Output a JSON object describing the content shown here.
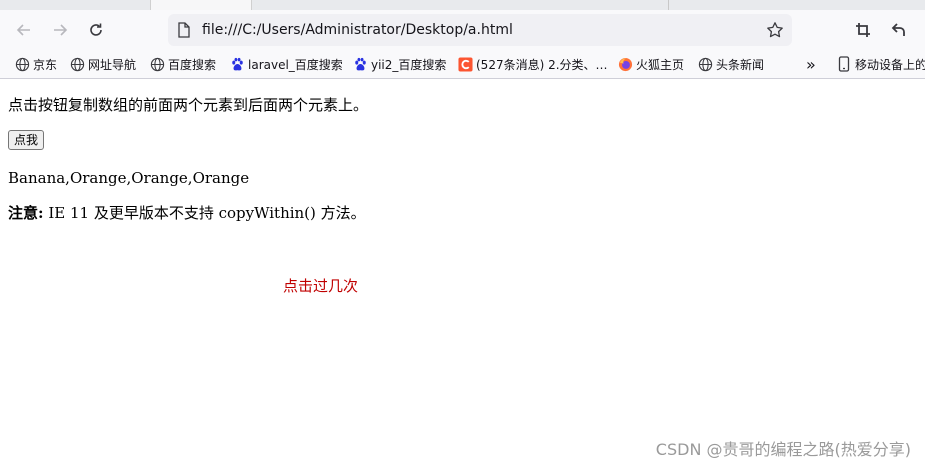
{
  "browser": {
    "url": "file:///C:/Users/Administrator/Desktop/a.html",
    "bookmarks": [
      {
        "label": "京东",
        "icon": "globe-icon"
      },
      {
        "label": "网址导航",
        "icon": "globe-icon"
      },
      {
        "label": "百度搜索",
        "icon": "globe-icon"
      },
      {
        "label": "laravel_百度搜索",
        "icon": "baidu-paw-icon"
      },
      {
        "label": "yii2_百度搜索",
        "icon": "baidu-paw-icon"
      },
      {
        "label": "(527条消息) 2.分类、…",
        "icon": "csdn-icon"
      },
      {
        "label": "火狐主页",
        "icon": "firefox-icon"
      },
      {
        "label": "头条新闻",
        "icon": "globe-icon"
      }
    ],
    "overflow_label": "»",
    "mobile_bookmarks": "移动设备上的书签",
    "colors": {
      "accent_red": "#c00000",
      "csdn_orange": "#fc5531",
      "baidu_blue": "#2932e1"
    }
  },
  "page": {
    "intro": "点击按钮复制数组的前面两个元素到后面两个元素上。",
    "button_label": "点我",
    "result": "Banana,Orange,Orange,Orange",
    "note_bold": "注意:",
    "note_text": " IE 11 及更早版本不支持 copyWithin() 方法。",
    "counter_text": "点击过几次"
  },
  "watermark": "CSDN @贵哥的编程之路(热爱分享)"
}
